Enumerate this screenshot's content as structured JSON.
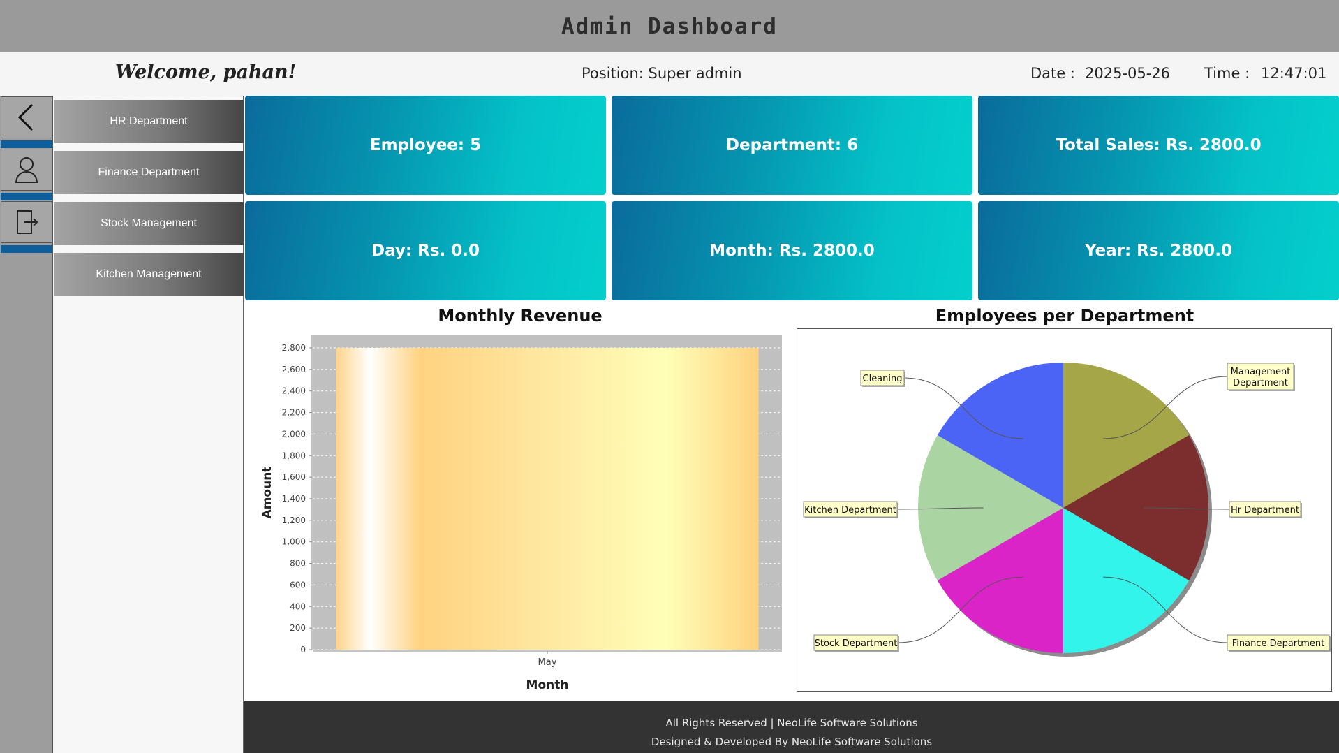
{
  "window": {
    "title": "Admin Dashboard"
  },
  "info": {
    "welcome": "Welcome, pahan!",
    "position": "Position: Super admin",
    "date_label": "Date :",
    "date_value": "2025-05-26",
    "time_label": "Time :",
    "time_value": "12:47:01"
  },
  "rail": {
    "icons": [
      "back-arrow-icon",
      "user-icon",
      "logout-icon"
    ]
  },
  "nav": {
    "items": [
      {
        "label": "HR Department"
      },
      {
        "label": "Finance Department"
      },
      {
        "label": "Stock Management"
      },
      {
        "label": "Kitchen Management"
      }
    ]
  },
  "cards": [
    {
      "label": "Employee: 5"
    },
    {
      "label": "Department: 6"
    },
    {
      "label": "Total Sales: Rs. 2800.0"
    },
    {
      "label": "Day: Rs. 0.0"
    },
    {
      "label": "Month: Rs. 2800.0"
    },
    {
      "label": "Year: Rs. 2800.0"
    }
  ],
  "chart_data": [
    {
      "type": "bar",
      "title": "Monthly Revenue",
      "xlabel": "Month",
      "ylabel": "Amount",
      "categories": [
        "May"
      ],
      "values": [
        2800
      ],
      "ylim": [
        0,
        2800
      ],
      "yticks": [
        0,
        200,
        400,
        600,
        800,
        1000,
        1200,
        1400,
        1600,
        1800,
        2000,
        2200,
        2400,
        2600,
        2800
      ],
      "ytick_labels": [
        "0",
        "200",
        "400",
        "600",
        "800",
        "1,000",
        "1,200",
        "1,400",
        "1,600",
        "1,800",
        "2,000",
        "2,200",
        "2,400",
        "2,600",
        "2,800"
      ],
      "grid": true,
      "colors": {
        "plot_bg": "#c0c0c0",
        "bar": "#ffd27f"
      }
    },
    {
      "type": "pie",
      "title": "Employees per Department",
      "slices": [
        {
          "label": "Management Department",
          "label_lines": [
            "Management",
            "Department"
          ],
          "value": 1,
          "color": "#a4a647"
        },
        {
          "label": "Hr Department",
          "value": 1,
          "color": "#7c2e2e"
        },
        {
          "label": "Finance Department",
          "value": 1,
          "color": "#33f4ea"
        },
        {
          "label": "Stock Department",
          "value": 1,
          "color": "#db24c8"
        },
        {
          "label": "Kitchen Department",
          "value": 1,
          "color": "#aad4a2"
        },
        {
          "label": "Cleaning",
          "value": 1,
          "color": "#4b64f5"
        }
      ]
    }
  ],
  "footer": {
    "line1": "All Rights Reserved | NeoLife Software Solutions",
    "line2": "Designed & Developed By NeoLife Software Solutions"
  }
}
